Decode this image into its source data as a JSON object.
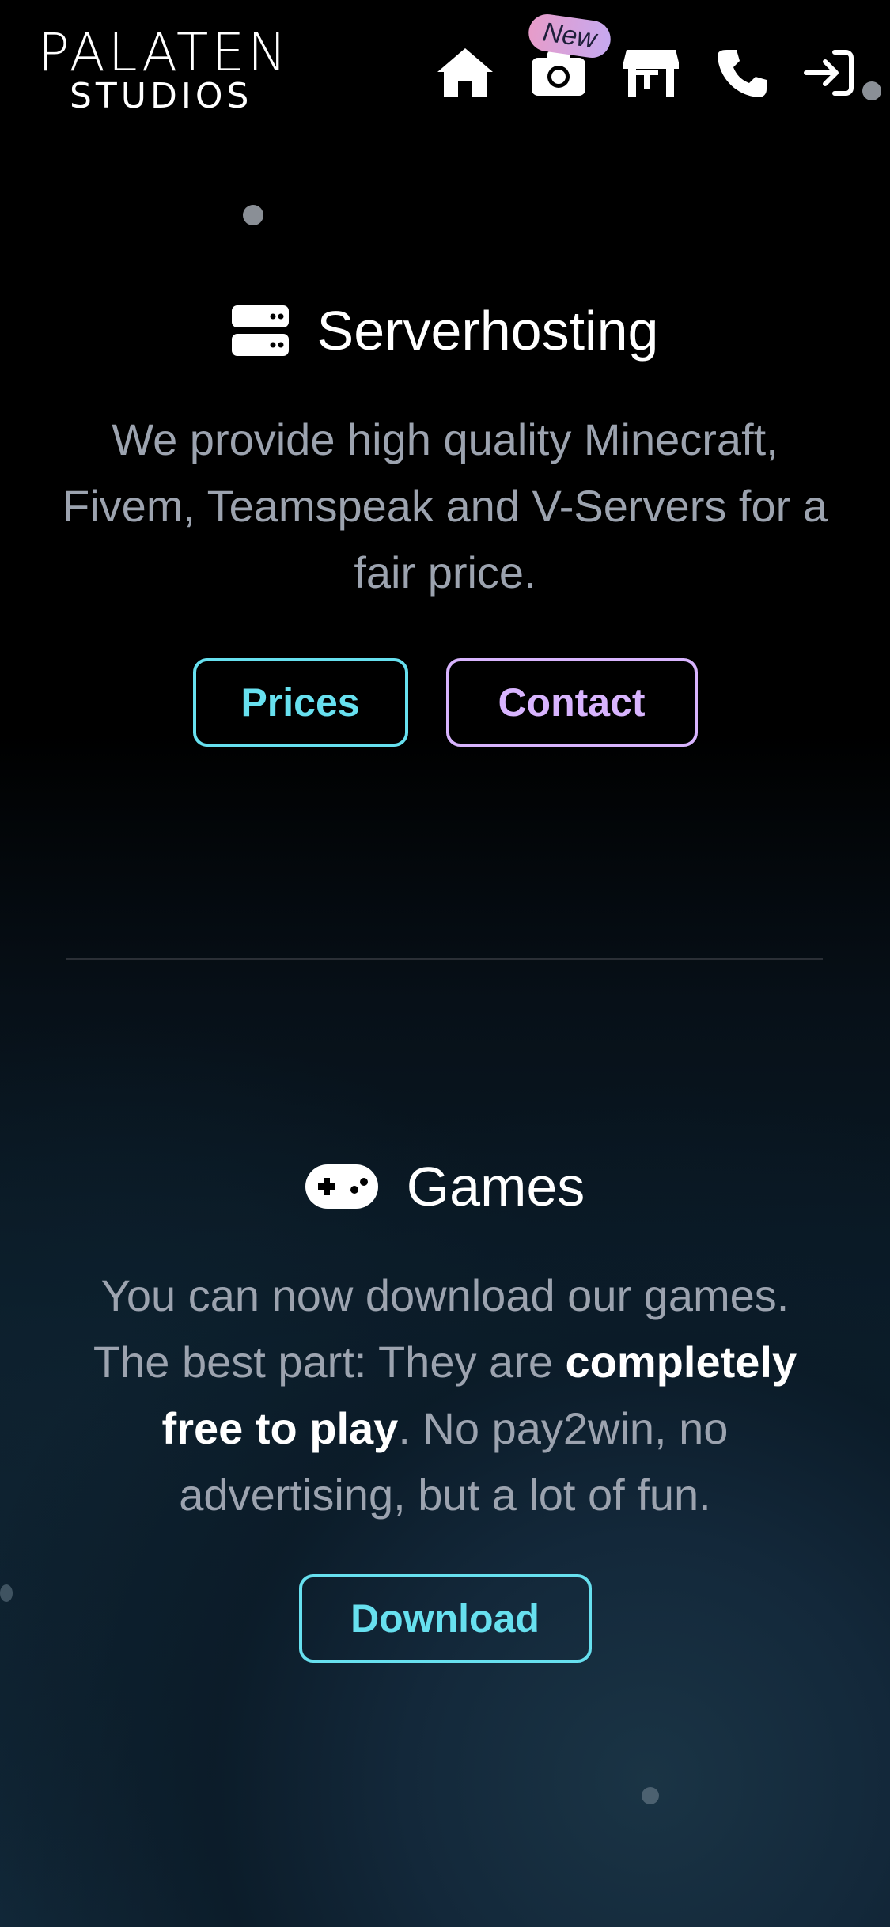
{
  "header": {
    "logo_line1": "PALATEN",
    "logo_line2": "STUDIOS",
    "nav": {
      "home_icon": "home-icon",
      "gallery_icon": "camera-icon",
      "new_badge": "New",
      "shop_icon": "store-icon",
      "contact_icon": "phone-icon",
      "login_icon": "login-icon"
    }
  },
  "serverhosting": {
    "icon": "server-icon",
    "title": "Serverhosting",
    "description": "We provide high quality Minecraft, Fivem, Teamspeak and V-Servers for a fair price.",
    "prices_button": "Prices",
    "contact_button": "Contact"
  },
  "games": {
    "icon": "gamepad-icon",
    "title": "Games",
    "description_before": "You can now download our games. The best part: They are ",
    "description_bold": "completely free to play",
    "description_after": ". No pay2win, no advertising, but a lot of fun.",
    "download_button": "Download"
  },
  "colors": {
    "accent_cyan": "#67e0ef",
    "accent_purple": "#d8b4fe",
    "text_muted": "#9ca3af",
    "background": "#000000"
  }
}
